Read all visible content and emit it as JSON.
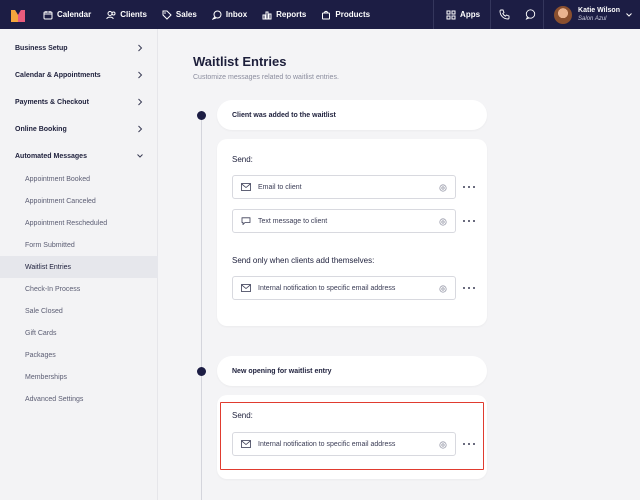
{
  "topnav": {
    "items": [
      {
        "label": "Calendar",
        "icon": "calendar-icon"
      },
      {
        "label": "Clients",
        "icon": "clients-icon"
      },
      {
        "label": "Sales",
        "icon": "tag-icon"
      },
      {
        "label": "Inbox",
        "icon": "chat-icon"
      },
      {
        "label": "Reports",
        "icon": "bar-chart-icon"
      },
      {
        "label": "Products",
        "icon": "bag-icon"
      }
    ],
    "apps_label": "Apps",
    "user": {
      "name": "Katie Wilson",
      "business": "Salon Azul"
    },
    "colors": {
      "background": "#1c1d44"
    }
  },
  "sidebar": {
    "sections": [
      {
        "label": "Business Setup"
      },
      {
        "label": "Calendar & Appointments"
      },
      {
        "label": "Payments & Checkout"
      },
      {
        "label": "Online Booking"
      },
      {
        "label": "Automated Messages"
      }
    ],
    "subitems": [
      {
        "label": "Appointment Booked"
      },
      {
        "label": "Appointment Canceled"
      },
      {
        "label": "Appointment Rescheduled"
      },
      {
        "label": "Form Submitted"
      },
      {
        "label": "Waitlist Entries"
      },
      {
        "label": "Check-In Process"
      },
      {
        "label": "Sale Closed"
      },
      {
        "label": "Gift Cards"
      },
      {
        "label": "Packages"
      },
      {
        "label": "Memberships"
      },
      {
        "label": "Advanced Settings"
      }
    ],
    "active_subitem": "Waitlist Entries"
  },
  "main": {
    "title": "Waitlist Entries",
    "subtitle": "Customize messages related to waitlist entries.",
    "steps": [
      {
        "title": "Client was added to the waitlist",
        "send_label": "Send:",
        "actions": [
          {
            "label": "Email to client",
            "icon": "mail-icon"
          },
          {
            "label": "Text message to client",
            "icon": "message-icon"
          }
        ],
        "conditional_label": "Send only when clients add themselves:",
        "conditional_actions": [
          {
            "label": "Internal notification to specific email address",
            "icon": "mail-icon"
          }
        ]
      },
      {
        "title": "New opening for waitlist entry",
        "send_label": "Send:",
        "actions": [
          {
            "label": "Internal notification to specific email address",
            "icon": "mail-icon"
          }
        ]
      }
    ],
    "highlight_color": "#e03b2f"
  }
}
